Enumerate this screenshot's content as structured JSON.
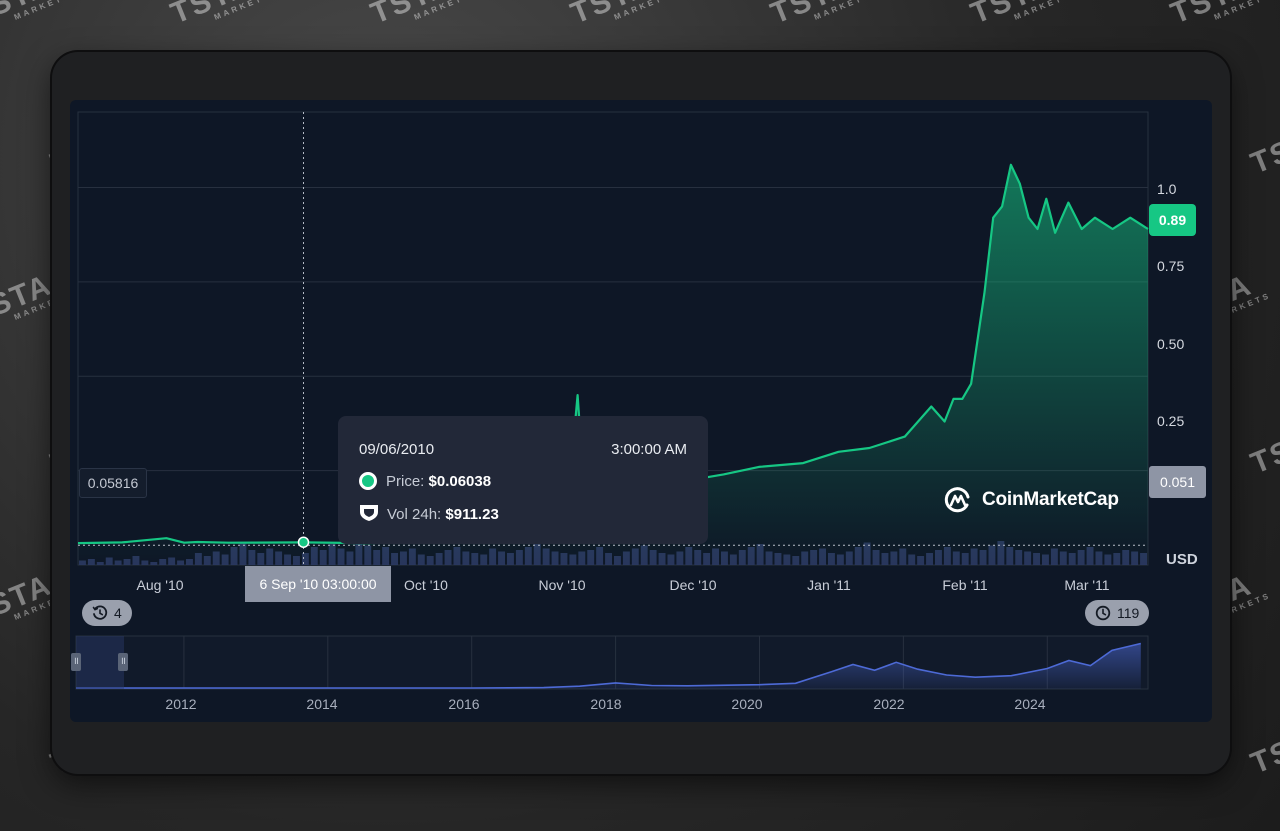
{
  "chart_data": {
    "type": "area",
    "currency": "USD",
    "x_ticks": [
      "Aug '10",
      "Oct '10",
      "Nov '10",
      "Dec '10",
      "Jan '11",
      "Feb '11",
      "Mar '11"
    ],
    "y_ticks": [
      "1.0",
      "0.75",
      "0.50",
      "0.25"
    ],
    "ylim": [
      0,
      1.2
    ],
    "series": [
      {
        "color": "#16c784",
        "x": [
          "2010-07-17",
          "2010-07-27",
          "2010-08-06",
          "2010-08-10",
          "2010-08-13",
          "2010-08-20",
          "2010-09-06",
          "2010-09-20",
          "2010-10-01",
          "2010-10-12",
          "2010-10-25",
          "2010-11-01",
          "2010-11-04",
          "2010-11-06",
          "2010-11-07",
          "2010-11-08",
          "2010-11-10",
          "2010-11-12",
          "2010-11-15",
          "2010-11-20",
          "2010-11-28",
          "2010-12-01",
          "2010-12-05",
          "2010-12-10",
          "2010-12-18",
          "2010-12-28",
          "2011-01-05",
          "2011-01-12",
          "2011-01-20",
          "2011-01-26",
          "2011-01-29",
          "2011-01-31",
          "2011-02-02",
          "2011-02-04",
          "2011-02-07",
          "2011-02-09",
          "2011-02-11",
          "2011-02-13",
          "2011-02-15",
          "2011-02-17",
          "2011-02-19",
          "2011-02-21",
          "2011-02-23",
          "2011-02-26",
          "2011-03-01",
          "2011-03-04",
          "2011-03-08",
          "2011-03-12",
          "2011-03-16"
        ],
        "y": [
          0.058,
          0.06,
          0.071,
          0.059,
          0.061,
          0.059,
          0.06,
          0.058,
          0.061,
          0.062,
          0.063,
          0.066,
          0.27,
          0.32,
          0.45,
          0.28,
          0.3,
          0.28,
          0.29,
          0.29,
          0.27,
          0.25,
          0.23,
          0.24,
          0.26,
          0.27,
          0.3,
          0.31,
          0.34,
          0.42,
          0.38,
          0.44,
          0.44,
          0.48,
          0.72,
          0.92,
          0.95,
          1.06,
          1.01,
          0.92,
          0.89,
          0.97,
          0.88,
          0.96,
          0.89,
          0.92,
          0.89,
          0.92,
          0.89
        ]
      }
    ],
    "volume_24h": [
      3,
      4,
      2,
      5,
      3,
      4,
      6,
      3,
      2,
      4,
      5,
      3,
      4,
      8,
      6,
      9,
      7,
      12,
      15,
      10,
      8,
      11,
      9,
      7,
      6,
      8,
      12,
      10,
      14,
      11,
      9,
      16,
      13,
      10,
      12,
      8,
      9,
      11,
      7,
      6,
      8,
      10,
      12,
      9,
      8,
      7,
      11,
      9,
      8,
      10,
      12,
      14,
      11,
      9,
      8,
      7,
      9,
      10,
      12,
      8,
      6,
      9,
      11,
      13,
      10,
      8,
      7,
      9,
      12,
      10,
      8,
      11,
      9,
      7,
      10,
      12,
      14,
      9,
      8,
      7,
      6,
      9,
      10,
      11,
      8,
      7,
      9,
      12,
      15,
      10,
      8,
      9,
      11,
      7,
      6,
      8,
      10,
      12,
      9,
      8,
      11,
      10,
      13,
      16,
      12,
      10,
      9,
      8,
      7,
      11,
      9,
      8,
      10,
      12,
      9,
      7,
      8,
      10,
      9,
      8
    ],
    "last_price": "0.89",
    "crosshair": {
      "date_label": "6 Sep '10 03:00:00",
      "price_label": "0.051",
      "left_price_label": "0.05816",
      "x": "2010-09-06",
      "y": 0.06038
    },
    "tooltip": {
      "date": "09/06/2010",
      "time": "3:00:00 AM",
      "price_label": "Price:",
      "price": "$0.06038",
      "volume_label": "Vol 24h:",
      "volume": "$911.23"
    },
    "unit_label": "USD",
    "brand": "CoinMarketCap",
    "navigator": {
      "x_ticks": [
        "2012",
        "2014",
        "2016",
        "2018",
        "2020",
        "2022",
        "2024"
      ],
      "x": [
        2010.5,
        2011,
        2012,
        2013,
        2014,
        2015,
        2016,
        2017,
        2017.5,
        2018,
        2018.5,
        2019,
        2020,
        2020.5,
        2021,
        2021.3,
        2021.6,
        2021.9,
        2022.2,
        2022.6,
        2023,
        2023.5,
        2024,
        2024.3,
        2024.6,
        2024.9,
        2025.3
      ],
      "y": [
        0,
        0,
        0,
        0,
        0,
        0,
        0,
        0.1,
        0.5,
        1.4,
        0.7,
        0.6,
        0.9,
        1.3,
        4.5,
        6.5,
        4.9,
        7.1,
        5.2,
        3.6,
        3.0,
        3.4,
        5.4,
        7.6,
        6.2,
        10.4,
        12.3
      ],
      "color": "#4d6ad6"
    },
    "range_start_label": "4",
    "range_end_label": "119"
  }
}
